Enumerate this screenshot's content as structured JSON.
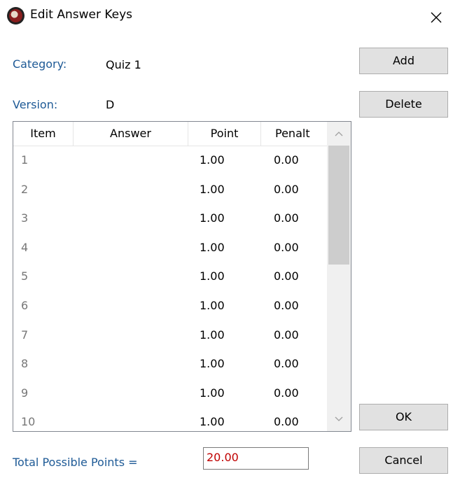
{
  "window": {
    "title": "Edit Answer Keys",
    "close_symbol": "✕",
    "app_icon": "app-logo-icon"
  },
  "form": {
    "category_label": "Category:",
    "category_value": "Quiz 1",
    "version_label": "Version:",
    "version_value": "D"
  },
  "buttons": {
    "add": "Add",
    "delete": "Delete",
    "ok": "OK",
    "cancel": "Cancel"
  },
  "grid": {
    "columns": [
      "Item",
      "Answer",
      "Point",
      "Penalt"
    ],
    "rows": [
      {
        "item": "1",
        "answer": "",
        "point": "1.00",
        "penalty": "0.00"
      },
      {
        "item": "2",
        "answer": "",
        "point": "1.00",
        "penalty": "0.00"
      },
      {
        "item": "3",
        "answer": "",
        "point": "1.00",
        "penalty": "0.00"
      },
      {
        "item": "4",
        "answer": "",
        "point": "1.00",
        "penalty": "0.00"
      },
      {
        "item": "5",
        "answer": "",
        "point": "1.00",
        "penalty": "0.00"
      },
      {
        "item": "6",
        "answer": "",
        "point": "1.00",
        "penalty": "0.00"
      },
      {
        "item": "7",
        "answer": "",
        "point": "1.00",
        "penalty": "0.00"
      },
      {
        "item": "8",
        "answer": "",
        "point": "1.00",
        "penalty": "0.00"
      },
      {
        "item": "9",
        "answer": "",
        "point": "1.00",
        "penalty": "0.00"
      },
      {
        "item": "10",
        "answer": "",
        "point": "1.00",
        "penalty": "0.00"
      }
    ],
    "scroll_up_symbol": "^",
    "scroll_down_symbol": "v"
  },
  "total": {
    "label": "Total Possible Points =",
    "value": "20.00"
  },
  "colors": {
    "label_blue": "#1e5a96",
    "total_value_red": "#c00000",
    "button_bg": "#e1e1e1"
  }
}
